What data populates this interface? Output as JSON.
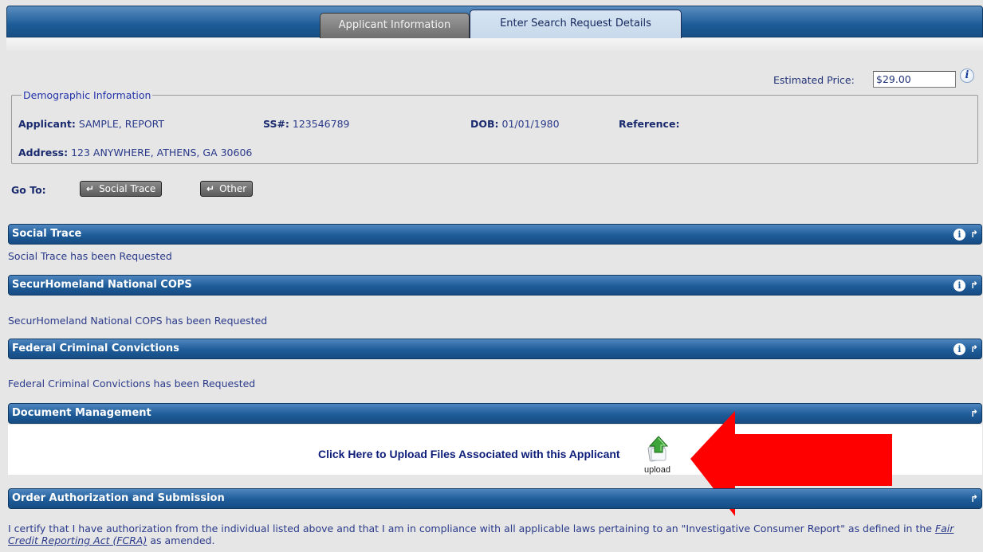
{
  "tabs": [
    {
      "label": "Applicant Information"
    },
    {
      "label": "Enter Search Request Details"
    }
  ],
  "price": {
    "label": "Estimated Price:",
    "value": "$29.00"
  },
  "demographic": {
    "legend": "Demographic Information",
    "applicant_label": "Applicant:",
    "applicant_value": "SAMPLE, REPORT",
    "ss_label": "SS#:",
    "ss_value": "123546789",
    "dob_label": "DOB:",
    "dob_value": "01/01/1980",
    "reference_label": "Reference:",
    "address_label": "Address:",
    "address_value": "123 ANYWHERE, ATHENS, GA 30606"
  },
  "goto": {
    "label": "Go To:",
    "buttons": [
      {
        "label": "Social Trace"
      },
      {
        "label": "Other"
      }
    ]
  },
  "sections": [
    {
      "title": "Social Trace",
      "status": "Social Trace has been Requested"
    },
    {
      "title": "SecurHomeland National COPS",
      "status": "SecurHomeland National COPS has been Requested"
    },
    {
      "title": "Federal Criminal Convictions",
      "status": "Federal Criminal Convictions has been Requested"
    },
    {
      "title": "Document Management"
    },
    {
      "title": "Order Authorization and Submission"
    }
  ],
  "upload": {
    "link_text": "Click Here to Upload Files Associated with this Applicant",
    "caption": "upload"
  },
  "certification": {
    "text_before": "I certify that I have authorization from the individual listed above and that I am in compliance with all applicable laws pertaining to an \"Investigative Consumer Report\" as defined in the ",
    "link": "Fair Credit Reporting Act (FCRA)",
    "text_after": " as amended."
  },
  "icons": {
    "info": "info-icon",
    "collapse": "collapse-arrow-icon",
    "upload": "upload-icon",
    "annotation": "red-arrow-pointer"
  },
  "colors": {
    "header_blue": "#1e5c99",
    "link_navy": "#0c1d7a",
    "annotation_red": "#ff0000"
  }
}
